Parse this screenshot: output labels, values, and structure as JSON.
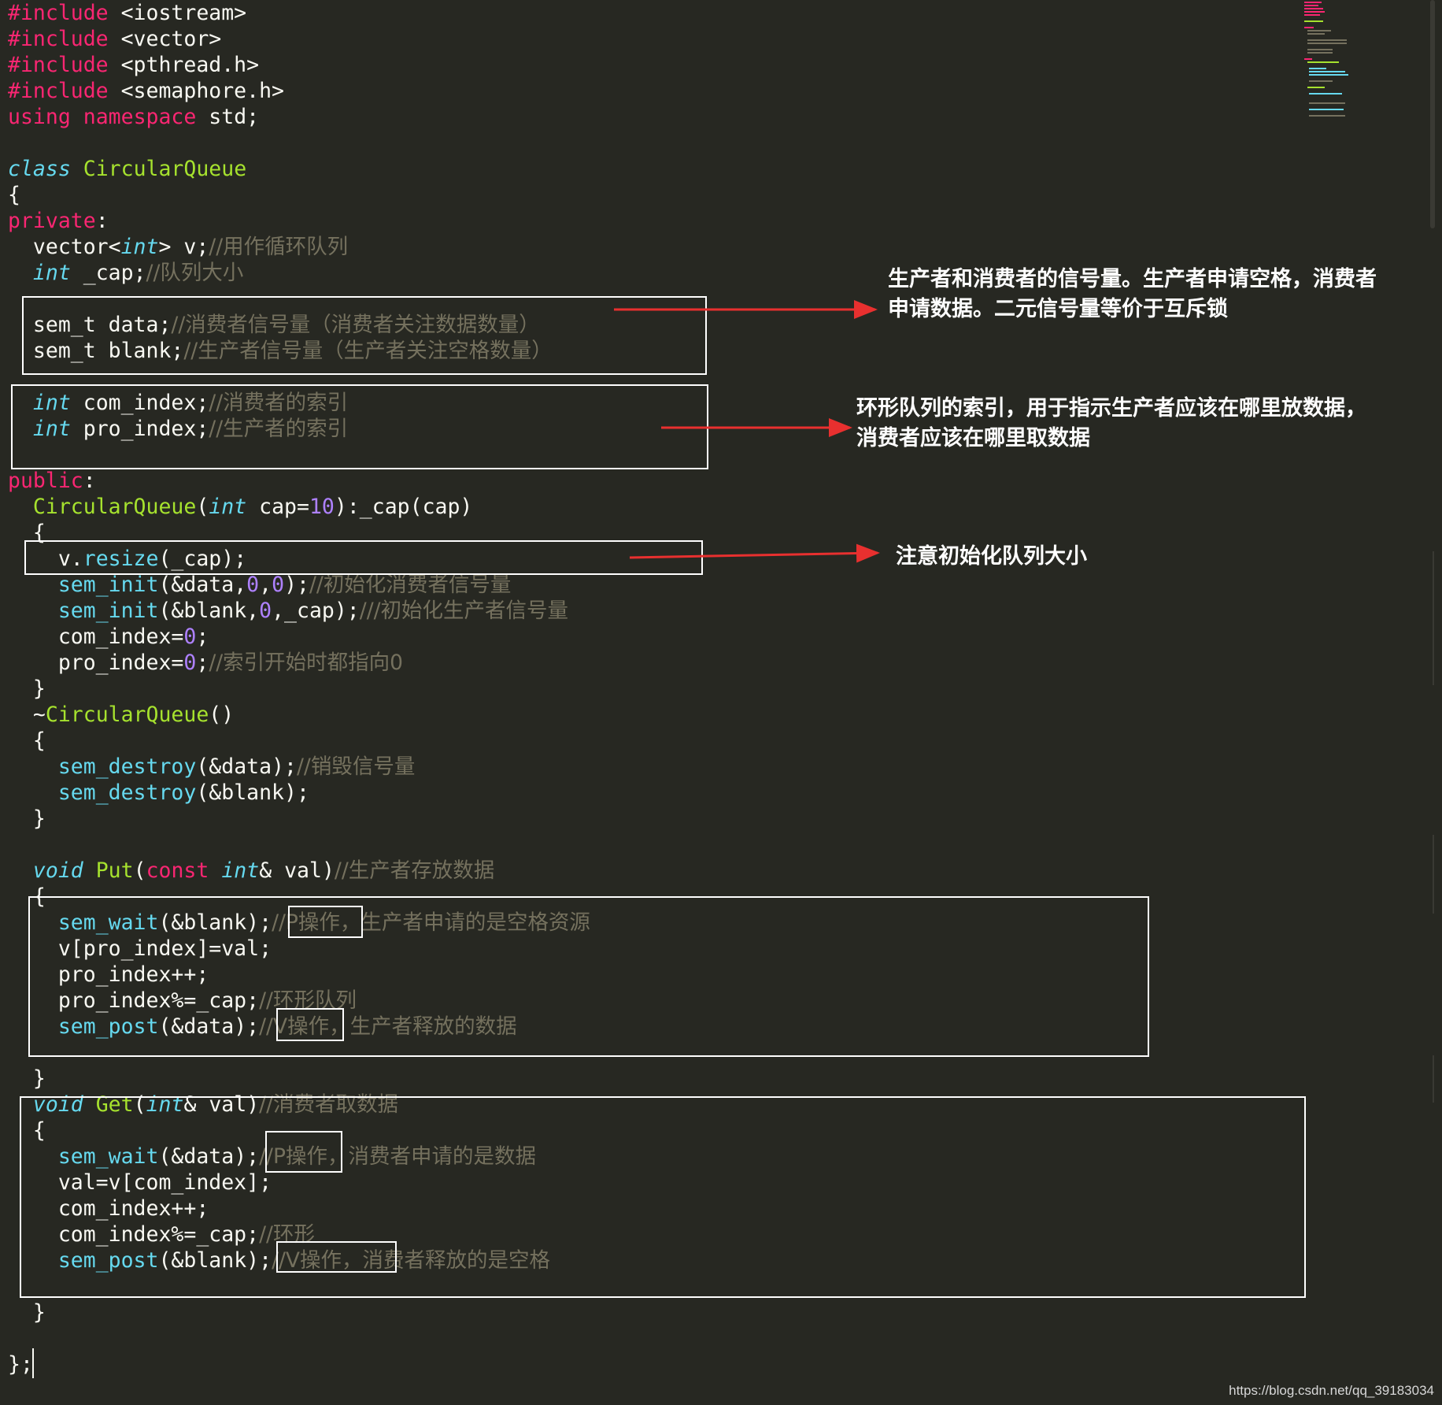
{
  "editor": {
    "theme_colors": {
      "background": "#272822",
      "keyword": "#F92672",
      "type": "#66D9EF",
      "function_def": "#A6E22E",
      "number": "#AE81FF",
      "comment": "#75715E",
      "plain": "#F8F8F2",
      "annotation_arrow": "#E8302F"
    },
    "code_lines": [
      [
        [
          "kw",
          "#include"
        ],
        [
          "pl",
          " <iostream>"
        ]
      ],
      [
        [
          "kw",
          "#include"
        ],
        [
          "pl",
          " <vector>"
        ]
      ],
      [
        [
          "kw",
          "#include"
        ],
        [
          "pl",
          " <pthread.h>"
        ]
      ],
      [
        [
          "kw",
          "#include"
        ],
        [
          "pl",
          " <semaphore.h>"
        ]
      ],
      [
        [
          "kw",
          "using"
        ],
        [
          "pl",
          " "
        ],
        [
          "kw",
          "namespace"
        ],
        [
          "pl",
          " std;"
        ]
      ],
      [],
      [
        [
          "ty",
          "class"
        ],
        [
          "pl",
          " "
        ],
        [
          "fn",
          "CircularQueue"
        ]
      ],
      [
        [
          "pl",
          "{"
        ]
      ],
      [
        [
          "kw",
          "private"
        ],
        [
          "pl",
          ":"
        ]
      ],
      [
        [
          "pl",
          "  vector<"
        ],
        [
          "ty",
          "int"
        ],
        [
          "pl",
          "> v;"
        ],
        [
          "cm",
          "//用作循环队列"
        ]
      ],
      [
        [
          "pl",
          "  "
        ],
        [
          "ty",
          "int"
        ],
        [
          "pl",
          " _cap;"
        ],
        [
          "cm",
          "//队列大小"
        ]
      ],
      [],
      [
        [
          "pl",
          "  sem_t data;"
        ],
        [
          "cm",
          "//消费者信号量（消费者关注数据数量）"
        ]
      ],
      [
        [
          "pl",
          "  sem_t blank;"
        ],
        [
          "cm",
          "//生产者信号量（生产者关注空格数量）"
        ]
      ],
      [],
      [
        [
          "pl",
          "  "
        ],
        [
          "ty",
          "int"
        ],
        [
          "pl",
          " com_index;"
        ],
        [
          "cm",
          "//消费者的索引"
        ]
      ],
      [
        [
          "pl",
          "  "
        ],
        [
          "ty",
          "int"
        ],
        [
          "pl",
          " pro_index;"
        ],
        [
          "cm",
          "//生产者的索引"
        ]
      ],
      [],
      [
        [
          "kw",
          "public"
        ],
        [
          "pl",
          ":"
        ]
      ],
      [
        [
          "pl",
          "  "
        ],
        [
          "fn",
          "CircularQueue"
        ],
        [
          "pl",
          "("
        ],
        [
          "ty",
          "int"
        ],
        [
          "pl",
          " cap="
        ],
        [
          "num",
          "10"
        ],
        [
          "pl",
          "):_cap(cap)"
        ]
      ],
      [
        [
          "pl",
          "  {"
        ]
      ],
      [
        [
          "pl",
          "    v."
        ],
        [
          "call",
          "resize"
        ],
        [
          "pl",
          "(_cap);"
        ]
      ],
      [
        [
          "pl",
          "    "
        ],
        [
          "call",
          "sem_init"
        ],
        [
          "pl",
          "(&data,"
        ],
        [
          "num",
          "0"
        ],
        [
          "pl",
          ","
        ],
        [
          "num",
          "0"
        ],
        [
          "pl",
          ");"
        ],
        [
          "cm",
          "//初始化消费者信号量"
        ]
      ],
      [
        [
          "pl",
          "    "
        ],
        [
          "call",
          "sem_init"
        ],
        [
          "pl",
          "(&blank,"
        ],
        [
          "num",
          "0"
        ],
        [
          "pl",
          ",_cap);"
        ],
        [
          "cm",
          "///初始化生产者信号量"
        ]
      ],
      [
        [
          "pl",
          "    com_index="
        ],
        [
          "num",
          "0"
        ],
        [
          "pl",
          ";"
        ]
      ],
      [
        [
          "pl",
          "    pro_index="
        ],
        [
          "num",
          "0"
        ],
        [
          "pl",
          ";"
        ],
        [
          "cm",
          "//索引开始时都指向0"
        ]
      ],
      [
        [
          "pl",
          "  }"
        ]
      ],
      [
        [
          "pl",
          "  ~"
        ],
        [
          "fn",
          "CircularQueue"
        ],
        [
          "pl",
          "()"
        ]
      ],
      [
        [
          "pl",
          "  {"
        ]
      ],
      [
        [
          "pl",
          "    "
        ],
        [
          "call",
          "sem_destroy"
        ],
        [
          "pl",
          "(&data);"
        ],
        [
          "cm",
          "//销毁信号量"
        ]
      ],
      [
        [
          "pl",
          "    "
        ],
        [
          "call",
          "sem_destroy"
        ],
        [
          "pl",
          "(&blank);"
        ]
      ],
      [
        [
          "pl",
          "  }"
        ]
      ],
      [],
      [
        [
          "pl",
          "  "
        ],
        [
          "ty",
          "void"
        ],
        [
          "pl",
          " "
        ],
        [
          "fn",
          "Put"
        ],
        [
          "pl",
          "("
        ],
        [
          "kw",
          "const"
        ],
        [
          "pl",
          " "
        ],
        [
          "ty",
          "int"
        ],
        [
          "pl",
          "& val)"
        ],
        [
          "cm",
          "//生产者存放数据"
        ]
      ],
      [
        [
          "pl",
          "  {"
        ]
      ],
      [
        [
          "pl",
          "    "
        ],
        [
          "call",
          "sem_wait"
        ],
        [
          "pl",
          "(&blank);"
        ],
        [
          "cm",
          "//P操作，生产者申请的是空格资源"
        ]
      ],
      [
        [
          "pl",
          "    v[pro_index]=val;"
        ]
      ],
      [
        [
          "pl",
          "    pro_index++;"
        ]
      ],
      [
        [
          "pl",
          "    pro_index%=_cap;"
        ],
        [
          "cm",
          "//环形队列"
        ]
      ],
      [
        [
          "pl",
          "    "
        ],
        [
          "call",
          "sem_post"
        ],
        [
          "pl",
          "(&data);"
        ],
        [
          "cm",
          "//V操作，生产者释放的数据"
        ]
      ],
      [],
      [
        [
          "pl",
          "  }"
        ]
      ],
      [
        [
          "pl",
          "  "
        ],
        [
          "ty",
          "void"
        ],
        [
          "pl",
          " "
        ],
        [
          "fn",
          "Get"
        ],
        [
          "pl",
          "("
        ],
        [
          "ty",
          "int"
        ],
        [
          "pl",
          "& val)"
        ],
        [
          "cm",
          "//消费者取数据"
        ]
      ],
      [
        [
          "pl",
          "  {"
        ]
      ],
      [
        [
          "pl",
          "    "
        ],
        [
          "call",
          "sem_wait"
        ],
        [
          "pl",
          "(&data);"
        ],
        [
          "cm",
          "//P操作，消费者申请的是数据"
        ]
      ],
      [
        [
          "pl",
          "    val=v[com_index];"
        ]
      ],
      [
        [
          "pl",
          "    com_index++;"
        ]
      ],
      [
        [
          "pl",
          "    com_index%=_cap;"
        ],
        [
          "cm",
          "//环形"
        ]
      ],
      [
        [
          "pl",
          "    "
        ],
        [
          "call",
          "sem_post"
        ],
        [
          "pl",
          "(&blank);"
        ],
        [
          "cm",
          "//V操作，消费者释放的是空格"
        ]
      ],
      [],
      [
        [
          "pl",
          "  }"
        ]
      ],
      [],
      [
        [
          "pl",
          "};"
        ]
      ]
    ]
  },
  "annotations": {
    "note_semaphores_line1": "生产者和消费者的信号量。生产者申请空格，消费者",
    "note_semaphores_line2": "申请数据。二元信号量等价于互斥锁",
    "note_index_line1": "环形队列的索引，用于指示生产者应该在哪里放数据，",
    "note_index_line2": "消费者应该在哪里取数据",
    "note_resize": "注意初始化队列大小"
  },
  "watermark": "https://blog.csdn.net/qq_39183034"
}
